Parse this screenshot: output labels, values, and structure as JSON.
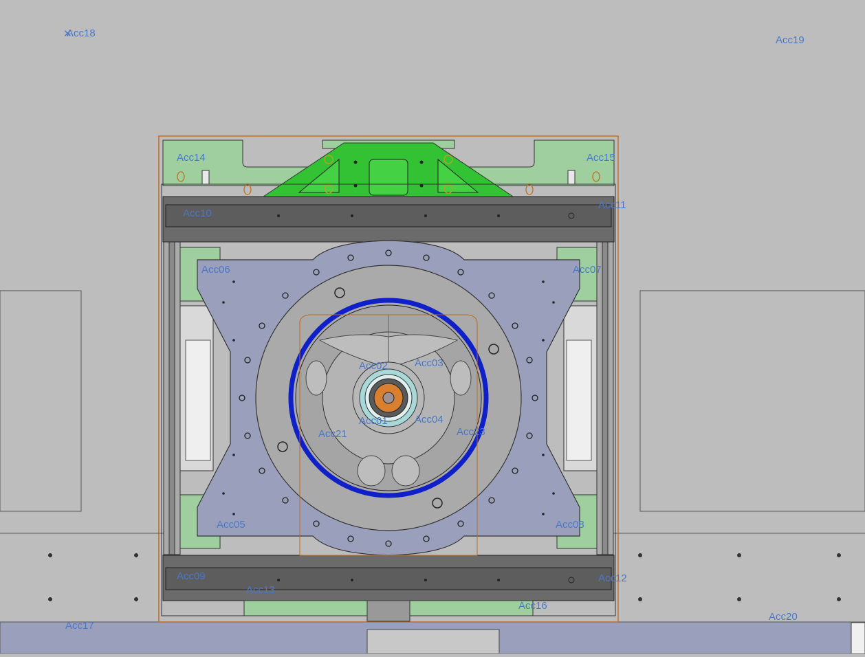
{
  "viewport": {
    "background": "#bdbdbd",
    "colors": {
      "frame_outline": "#c06a1a",
      "bracket_green": "#33c233",
      "plate_purple": "#9aa0bb",
      "ring_blue": "#1020c8",
      "beam_dark": "#6b6b6b",
      "green_fill": "#9fcf9f",
      "marker_blue": "#4a78c8"
    },
    "markers": [
      {
        "id": "acc18",
        "label": "Acc18"
      },
      {
        "id": "acc19",
        "label": "Acc19"
      },
      {
        "id": "acc14",
        "label": "Acc14"
      },
      {
        "id": "acc15",
        "label": "Acc15"
      },
      {
        "id": "acc10",
        "label": "Acc10"
      },
      {
        "id": "acc11",
        "label": "Acc11"
      },
      {
        "id": "acc06",
        "label": "Acc06"
      },
      {
        "id": "acc07",
        "label": "Acc07"
      },
      {
        "id": "acc02",
        "label": "Acc02"
      },
      {
        "id": "acc03",
        "label": "Acc03"
      },
      {
        "id": "acc01",
        "label": "Acc01"
      },
      {
        "id": "acc04",
        "label": "Acc04"
      },
      {
        "id": "acc21",
        "label": "Acc21"
      },
      {
        "id": "acc23",
        "label": "Acc23"
      },
      {
        "id": "acc05",
        "label": "Acc05"
      },
      {
        "id": "acc08",
        "label": "Acc08"
      },
      {
        "id": "acc09",
        "label": "Acc09"
      },
      {
        "id": "acc12",
        "label": "Acc12"
      },
      {
        "id": "acc13",
        "label": "Acc13"
      },
      {
        "id": "acc16",
        "label": "Acc16"
      },
      {
        "id": "acc17",
        "label": "Acc17"
      },
      {
        "id": "acc20",
        "label": "Acc20"
      }
    ]
  }
}
